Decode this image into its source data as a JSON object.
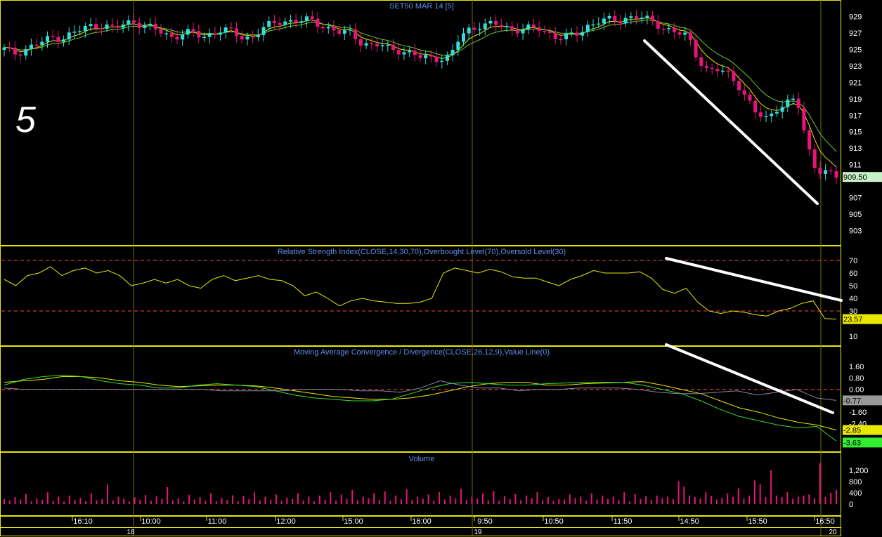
{
  "label_big": "5",
  "colors": {
    "frame": "#e8e800",
    "bull": "#33dddd",
    "bear": "#e8147c",
    "ma_fast": "#e8e800",
    "ma_slow": "#66cc33",
    "overbought": "#ff4444",
    "volume": "#e8147c",
    "trend": "#ffffff"
  },
  "chart_data": [
    {
      "type": "candlestick",
      "title": "SET50 MAR 14   [5]",
      "ylim": [
        902,
        930
      ],
      "yticks": [
        929,
        927,
        925,
        923,
        921,
        919,
        917,
        915,
        913,
        911,
        909.5,
        907,
        905,
        903
      ],
      "last_value": "909.50",
      "close_path": [
        925,
        924.5,
        925,
        925.5,
        926,
        926.5,
        926.5,
        927,
        927.5,
        928,
        928,
        927.5,
        928,
        928.5,
        928,
        927.5,
        927,
        926.5,
        927,
        927,
        926.5,
        927,
        927.5,
        927,
        926.5,
        926.5,
        927.5,
        928,
        928.5,
        928.5,
        928.5,
        928.5,
        928,
        927.5,
        927,
        927,
        926,
        925.5,
        925.5,
        925,
        925,
        924.5,
        924,
        924,
        924,
        924,
        926.5,
        927.5,
        928,
        928,
        928,
        927.5,
        927.5,
        927.5,
        927.5,
        927,
        926.5,
        926.5,
        927,
        928,
        928.5,
        928.5,
        928.5,
        929,
        929,
        928.5,
        928,
        927.5,
        927,
        926.5,
        924,
        922.5,
        922.5,
        922,
        921,
        919,
        917,
        916.5,
        918,
        918.5,
        919,
        913.5,
        910.5,
        910,
        909.5
      ]
    },
    {
      "type": "line",
      "title": "Relative Strength Index(CLOSE,14,30,70),Overbought Level(70),Oversold Level(30)",
      "ylim": [
        5,
        75
      ],
      "yticks": [
        70,
        60,
        50,
        40,
        30,
        23.57,
        10
      ],
      "levels": [
        70,
        30
      ],
      "last_value": "23.57",
      "values": [
        55,
        50,
        58,
        60,
        65,
        58,
        62,
        64,
        60,
        62,
        58,
        50,
        52,
        55,
        52,
        55,
        50,
        48,
        55,
        58,
        54,
        56,
        58,
        55,
        54,
        50,
        42,
        45,
        40,
        34,
        38,
        40,
        38,
        37,
        36,
        36,
        37,
        40,
        60,
        64,
        62,
        60,
        63,
        61,
        57,
        56,
        56,
        53,
        50,
        55,
        58,
        62,
        60,
        60,
        60,
        61,
        56,
        47,
        44,
        48,
        37,
        30,
        28,
        30,
        29,
        27,
        26,
        30,
        32,
        36,
        38,
        24,
        23.57
      ]
    },
    {
      "type": "line",
      "title": "Moving Average Convergence / Divergence(CLOSE,26,12,9),Value Line(0)",
      "ylim": [
        -4.2,
        2.4
      ],
      "yticks": [
        1.6,
        0.8,
        0.0,
        -0.77,
        -1.6,
        -2.4,
        -2.85,
        -3.63
      ],
      "last_values": [
        "-0.77",
        "-2.85",
        "-3.63"
      ],
      "series": [
        {
          "values": [
            0.5,
            0.6,
            0.7,
            0.9,
            0.9,
            0.8,
            0.6,
            0.5,
            0.3,
            0.2,
            0.25,
            0.3,
            0.3,
            0.25,
            0.1,
            -0.1,
            -0.3,
            -0.5,
            -0.6,
            -0.7,
            -0.7,
            -0.6,
            -0.4,
            -0.1,
            0.2,
            0.4,
            0.5,
            0.5,
            0.3,
            0.3,
            0.4,
            0.45,
            0.5,
            0.55,
            0.3,
            0.0,
            -0.3,
            -0.8,
            -1.3,
            -1.6,
            -2.0,
            -2.3,
            -2.5,
            -2.85
          ]
        },
        {
          "values": [
            0.3,
            0.7,
            0.9,
            1.0,
            0.9,
            0.6,
            0.4,
            0.3,
            0.1,
            0.1,
            0.3,
            0.4,
            0.3,
            0.2,
            -0.1,
            -0.4,
            -0.6,
            -0.7,
            -0.8,
            -0.8,
            -0.7,
            -0.3,
            0.1,
            0.4,
            0.5,
            0.4,
            0.3,
            0.3,
            0.4,
            0.45,
            0.5,
            0.5,
            0.5,
            0.3,
            0.0,
            -0.3,
            -0.8,
            -1.4,
            -1.9,
            -2.2,
            -2.5,
            -2.7,
            -2.6,
            -3.63
          ]
        },
        {
          "values": [
            0.1,
            0.0,
            0.0,
            0.0,
            0.0,
            0.0,
            0.0,
            0.0,
            0.0,
            0.0,
            0.0,
            -0.1,
            -0.1,
            -0.1,
            -0.1,
            0.0,
            0.0,
            0.0,
            -0.1,
            -0.1,
            -0.2,
            0.1,
            0.6,
            0.3,
            0.1,
            0.1,
            -0.1,
            0.0,
            0.0,
            0.1,
            0.1,
            0.1,
            0.0,
            -0.2,
            -0.3,
            -0.3,
            -0.2,
            -0.1,
            -0.4,
            -0.2,
            0.0,
            -0.6,
            -0.77
          ]
        }
      ]
    },
    {
      "type": "bar",
      "title": "Volume",
      "ylim": [
        -50,
        1450
      ],
      "yticks": [
        "1,200",
        "800",
        "400",
        "0"
      ],
      "values": [
        180,
        120,
        250,
        160,
        350,
        90,
        200,
        150,
        420,
        110,
        260,
        90,
        300,
        140,
        220,
        100,
        380,
        130,
        170,
        700,
        120,
        260,
        190,
        90,
        240,
        150,
        320,
        110,
        270,
        180,
        600,
        130,
        210,
        90,
        330,
        160,
        250,
        120,
        380,
        100,
        220,
        140,
        310,
        90,
        280,
        170,
        420,
        120,
        260,
        150,
        340,
        110,
        230,
        180,
        380,
        130,
        260,
        90,
        300,
        150,
        420,
        120,
        340,
        180,
        500,
        130,
        260,
        200,
        380,
        150,
        450,
        120,
        300,
        170,
        520,
        140,
        260,
        180,
        340,
        120,
        420,
        160,
        300,
        200,
        540,
        140,
        260,
        190,
        380,
        130,
        460,
        110,
        280,
        170,
        350,
        140,
        300,
        200,
        420,
        130,
        250,
        110,
        180,
        160,
        340,
        210,
        260,
        120,
        380,
        160,
        300,
        180,
        260,
        130,
        420,
        90,
        350,
        180,
        280,
        150,
        300,
        200,
        260,
        170,
        800,
        620,
        300,
        250,
        190,
        420,
        280,
        160,
        220,
        380,
        250,
        560,
        200,
        300,
        840,
        700,
        250,
        1200,
        300,
        250,
        420,
        180,
        260,
        300,
        340,
        200,
        1450,
        250,
        400,
        500
      ]
    }
  ],
  "xaxis": {
    "time_labels": [
      "16:10",
      "10:00",
      "11:00",
      "12:00",
      "15:00",
      "16:00",
      "9:50",
      "10:50",
      "11:50",
      "14:50",
      "15:50",
      "16:50"
    ],
    "date_labels": [
      "18",
      "19",
      "20"
    ]
  }
}
